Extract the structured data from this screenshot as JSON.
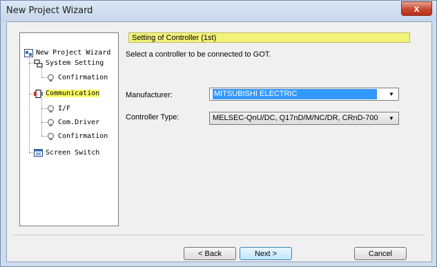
{
  "window": {
    "title": "New Project Wizard",
    "close_label": "x"
  },
  "tree": {
    "root": "New Project Wizard",
    "system_setting": "System Setting",
    "confirmation_1": "Confirmation",
    "communication": "Communication",
    "if": "I/F",
    "com_driver": "Com.Driver",
    "confirmation_2": "Confirmation",
    "screen_switch": "Screen Switch"
  },
  "page": {
    "header": "Setting of Controller (1st)",
    "description": "Select a controller to be connected to GOT.",
    "manufacturer_label": "Manufacturer:",
    "manufacturer_value": "MITSUBISHI ELECTRIC",
    "controller_type_label": "Controller Type:",
    "controller_type_value": "MELSEC-QnU/DC, Q17nD/M/NC/DR, CRnD-700"
  },
  "buttons": {
    "back": "< Back",
    "next": "Next >",
    "cancel": "Cancel"
  },
  "colors": {
    "highlight": "#ffff66",
    "selection": "#3399ff",
    "close": "#c7482f"
  }
}
